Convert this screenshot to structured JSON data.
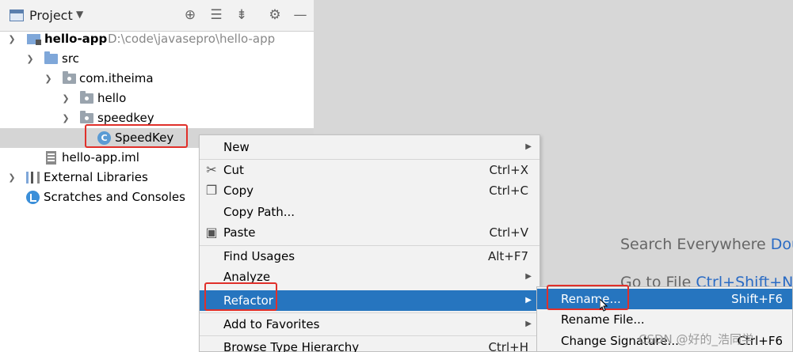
{
  "panel": {
    "title": "Project",
    "header_icons": [
      "crosshair-icon",
      "expand-all-icon",
      "collapse-all-icon",
      "gear-icon",
      "minimize-icon"
    ]
  },
  "tree": [
    {
      "label": "hello-app",
      "path": "D:\\code\\javasepro\\hello-app",
      "icon": "module-folder-icon",
      "arrow": "expanded"
    },
    {
      "label": "src",
      "icon": "source-folder-icon",
      "arrow": "expanded"
    },
    {
      "label": "com.itheima",
      "icon": "package-icon",
      "arrow": "expanded"
    },
    {
      "label": "hello",
      "icon": "package-icon",
      "arrow": "collapsed"
    },
    {
      "label": "speedkey",
      "icon": "package-icon",
      "arrow": "expanded"
    },
    {
      "label": "SpeedKey",
      "icon": "java-class-icon",
      "selected": true
    },
    {
      "label": "hello-app.iml",
      "icon": "iml-file-icon"
    },
    {
      "label": "External Libraries",
      "icon": "library-icon",
      "arrow": "collapsed"
    },
    {
      "label": "Scratches and Consoles",
      "icon": "scratch-icon"
    }
  ],
  "editor_hints": {
    "search_text": "Search Everywhere",
    "search_key": "Dou",
    "goto_text": "Go to File",
    "goto_key": "Ctrl+Shift+N"
  },
  "menu": {
    "items": [
      {
        "label": "New",
        "submenu": true
      },
      {
        "label": "Cut",
        "shortcut": "Ctrl+X",
        "icon": "scissors-icon"
      },
      {
        "label": "Copy",
        "shortcut": "Ctrl+C",
        "icon": "copy-icon"
      },
      {
        "label": "Copy Path..."
      },
      {
        "label": "Paste",
        "shortcut": "Ctrl+V",
        "icon": "paste-icon"
      },
      {
        "label": "Find Usages",
        "shortcut": "Alt+F7"
      },
      {
        "label": "Analyze",
        "submenu": true
      },
      {
        "label": "Refactor",
        "submenu": true,
        "active": true
      },
      {
        "label": "Add to Favorites",
        "submenu": true
      },
      {
        "label": "Browse Type Hierarchy",
        "shortcut": "Ctrl+H"
      }
    ]
  },
  "submenu": {
    "items": [
      {
        "label": "Rename...",
        "shortcut": "Shift+F6",
        "active": true
      },
      {
        "label": "Rename File..."
      },
      {
        "label": "Change Signature...",
        "shortcut": "Ctrl+F6"
      }
    ]
  },
  "watermark": "CSDN @好的_浩同学",
  "colors": {
    "selection": "#2675bf",
    "highlight_box": "#e0302a",
    "hint_key": "#2a6bc4"
  }
}
